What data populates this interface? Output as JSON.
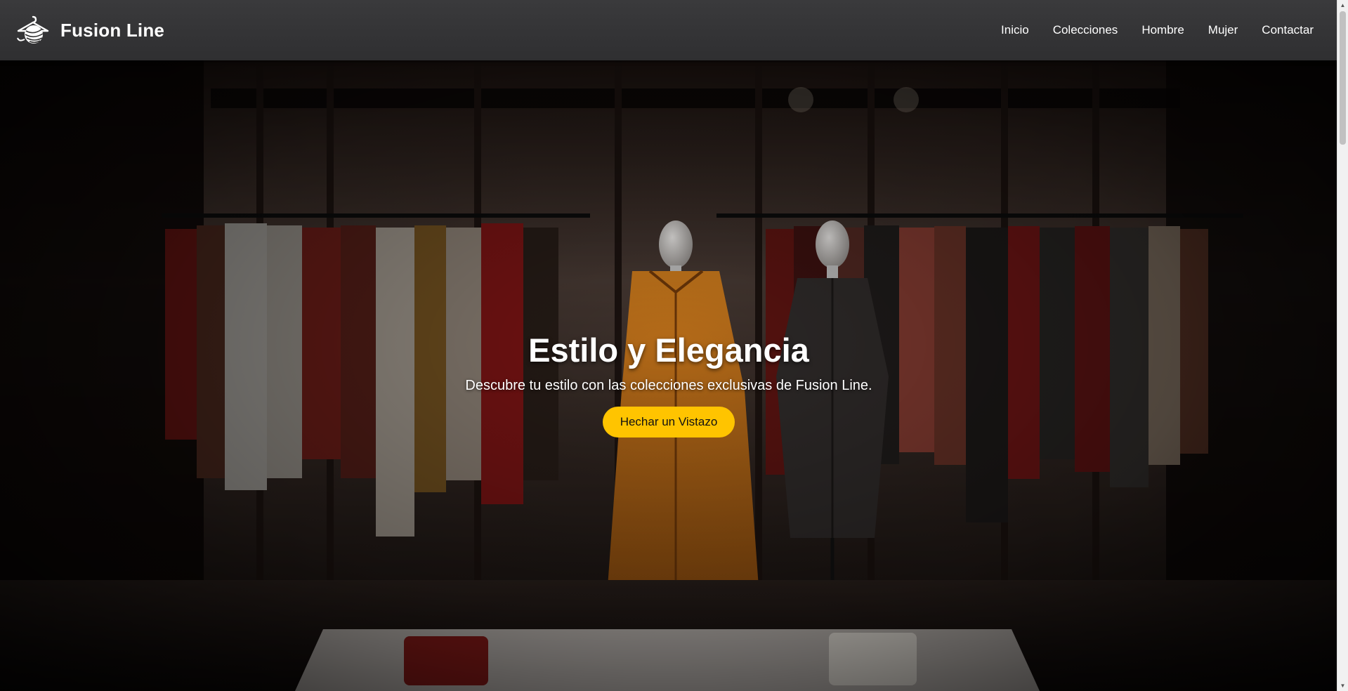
{
  "header": {
    "brand_name": "Fusion Line",
    "logo_icon": "hanger-yarn-icon",
    "nav": [
      {
        "label": "Inicio"
      },
      {
        "label": "Colecciones"
      },
      {
        "label": "Hombre"
      },
      {
        "label": "Mujer"
      },
      {
        "label": "Contactar"
      }
    ]
  },
  "hero": {
    "title": "Estilo y Elegancia",
    "subtitle": "Descubre tu estilo con las colecciones exclusivas de Fusion Line.",
    "button_label": "Hechar un Vistazo",
    "background_image": "clothing-store-mannequins-image"
  },
  "colors": {
    "header_bg": "#333335",
    "accent_button": "#ffc400",
    "text_primary": "#ffffff"
  }
}
